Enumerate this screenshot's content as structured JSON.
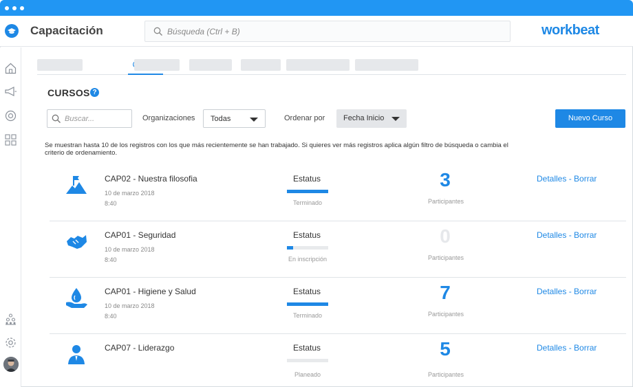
{
  "app": {
    "title": "Capacitación",
    "brand": "workbeat"
  },
  "search": {
    "placeholder": "Búsqueda (Ctrl + B)"
  },
  "tabs": {
    "active": "Cursos"
  },
  "section": {
    "title": "CURSOS",
    "help": "?"
  },
  "filters": {
    "search_placeholder": "Buscar...",
    "org_label": "Organizaciones",
    "org_value": "Todas",
    "sort_label": "Ordenar por",
    "sort_value": "Fecha Inicio",
    "new_button": "Nuevo Curso"
  },
  "notice": "Se muestran hasta 10 de los registros con los que más recientemente se han trabajado. Si quieres ver más registros aplica algún filtro de búsqueda o cambia el criterio de ordenamiento.",
  "colors": {
    "accent": "#1e88e5",
    "chrome": "#2196f3"
  },
  "courses": [
    {
      "icon": "mountain-flag-icon",
      "title": "CAP02 - Nuestra filosofia",
      "date": "10 de marzo 2018",
      "time": "8:40",
      "status_label": "Estatus",
      "progress": 1.0,
      "status": "Terminado",
      "count": "3",
      "count_label": "Participantes",
      "actions": "Detalles - Borrar"
    },
    {
      "icon": "handshake-icon",
      "title": "CAP01 - Seguridad",
      "date": "10 de marzo 2018",
      "time": "8:40",
      "status_label": "Estatus",
      "progress": 0.15,
      "status": "En inscripción",
      "count": "0",
      "count_label": "Participantes",
      "actions": "Detalles - Borrar"
    },
    {
      "icon": "water-drop-hand-icon",
      "title": "CAP01 -  Higiene y Salud",
      "date": "10 de marzo 2018",
      "time": "8:40",
      "status_label": "Estatus",
      "progress": 1.0,
      "status": "Terminado",
      "count": "7",
      "count_label": "Participantes",
      "actions": "Detalles - Borrar"
    },
    {
      "icon": "leader-icon",
      "title": "CAP07 - Liderazgo",
      "date": "",
      "time": "",
      "status_label": "Estatus",
      "progress": 0,
      "status": "Planeado",
      "count": "5",
      "count_label": "Participantes",
      "actions": "Detalles - Borrar"
    }
  ]
}
